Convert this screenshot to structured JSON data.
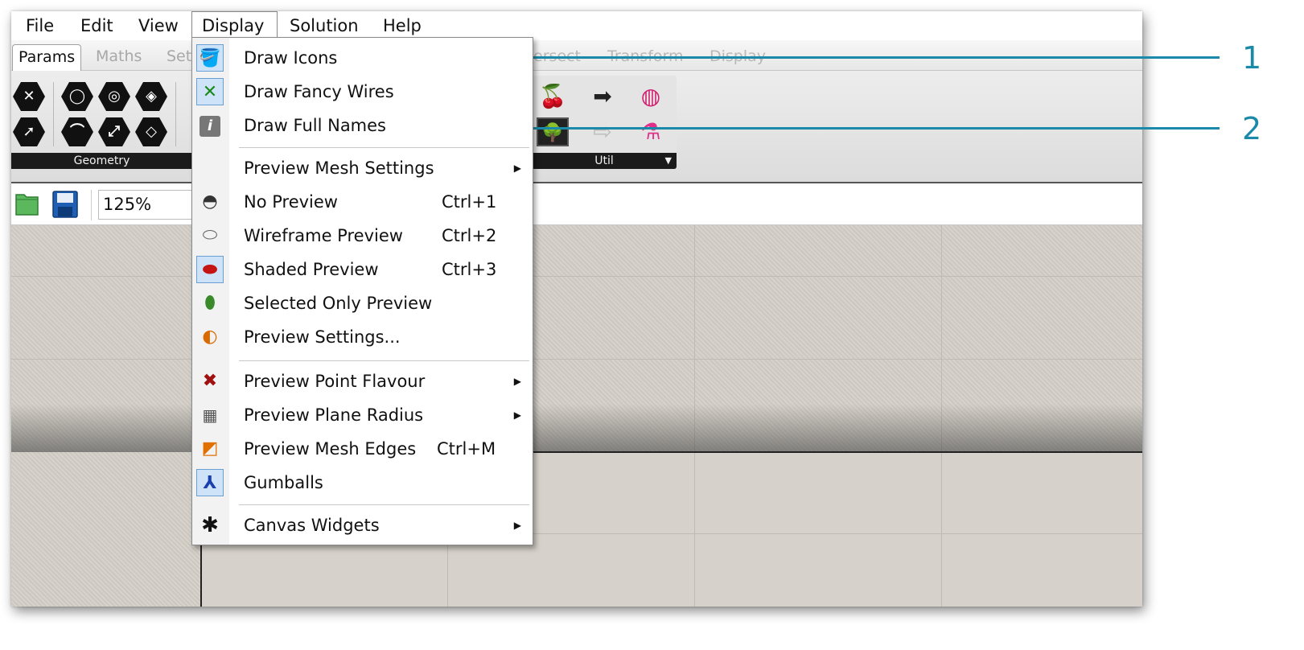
{
  "menubar": {
    "items": [
      {
        "label": "File"
      },
      {
        "label": "Edit"
      },
      {
        "label": "View"
      },
      {
        "label": "Display"
      },
      {
        "label": "Solution"
      },
      {
        "label": "Help"
      }
    ]
  },
  "tabs": [
    {
      "label": "Params"
    },
    {
      "label": "Maths"
    },
    {
      "label": "Set"
    },
    {
      "label": "ersect"
    },
    {
      "label": "Transform"
    },
    {
      "label": "Display"
    }
  ],
  "ribbon": {
    "groups": [
      {
        "label": "Geometry"
      },
      {
        "label": "Util"
      }
    ]
  },
  "toolbar": {
    "zoom": "125%"
  },
  "display_menu": {
    "items": [
      {
        "label": "Draw Icons",
        "checked": true,
        "icon": "paint-bucket-icon"
      },
      {
        "label": "Draw Fancy Wires",
        "checked": true,
        "icon": "fancy-wires-icon"
      },
      {
        "label": "Draw Full Names",
        "checked": false,
        "icon": "info-icon"
      },
      {
        "label": "Preview Mesh Settings",
        "submenu": true
      },
      {
        "label": "No Preview",
        "shortcut": "Ctrl+1",
        "icon": "no-preview-icon"
      },
      {
        "label": "Wireframe Preview",
        "shortcut": "Ctrl+2",
        "icon": "wireframe-icon"
      },
      {
        "label": "Shaded Preview",
        "shortcut": "Ctrl+3",
        "checked": true,
        "icon": "shaded-icon"
      },
      {
        "label": "Selected Only Preview",
        "icon": "selected-only-icon"
      },
      {
        "label": "Preview Settings...",
        "icon": "preview-settings-icon"
      },
      {
        "label": "Preview Point Flavour",
        "submenu": true,
        "icon": "point-flavour-icon"
      },
      {
        "label": "Preview Plane Radius",
        "submenu": true,
        "icon": "plane-radius-icon"
      },
      {
        "label": "Preview Mesh Edges",
        "shortcut": "Ctrl+M",
        "icon": "mesh-edges-icon"
      },
      {
        "label": "Gumballs",
        "checked": true,
        "icon": "gumball-icon"
      },
      {
        "label": "Canvas Widgets",
        "submenu": true,
        "icon": "canvas-widgets-icon"
      }
    ]
  },
  "callouts": [
    {
      "number": "1"
    },
    {
      "number": "2"
    }
  ],
  "colors": {
    "callout": "#1a8aa8",
    "canvas": "#d3cec6",
    "checked_icon_bg": "#cfe3f8"
  }
}
